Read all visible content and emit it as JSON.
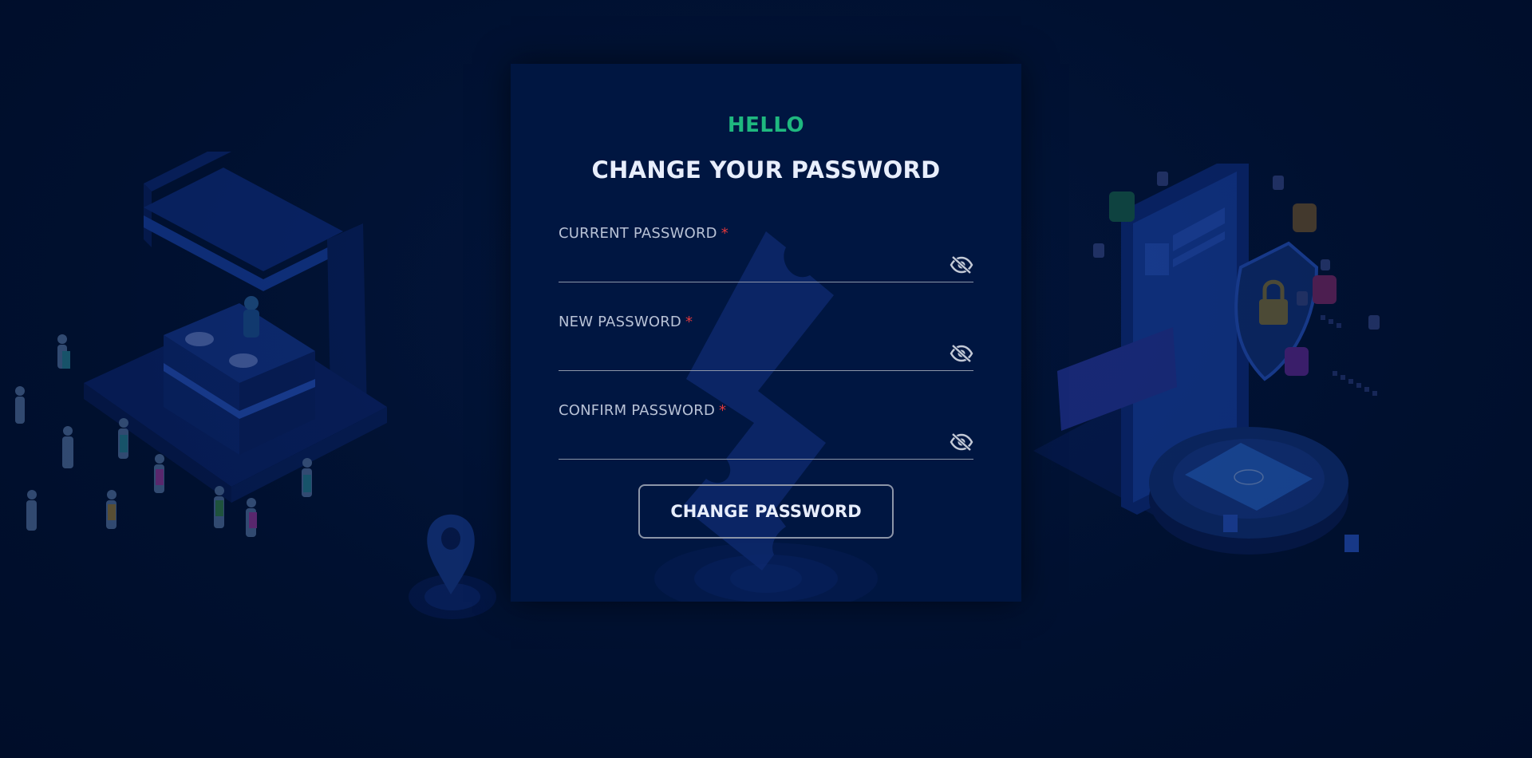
{
  "form": {
    "greeting": "HELLO",
    "title": "CHANGE YOUR PASSWORD",
    "fields": [
      {
        "label": "CURRENT PASSWORD",
        "required_mark": "*",
        "value": "",
        "icon": "eye-slash-icon"
      },
      {
        "label": "NEW PASSWORD",
        "required_mark": "*",
        "value": "",
        "icon": "eye-slash-icon"
      },
      {
        "label": "CONFIRM PASSWORD",
        "required_mark": "*",
        "value": "",
        "icon": "eye-slash-icon"
      }
    ],
    "submit_label": "CHANGE PASSWORD"
  },
  "colors": {
    "background": "#001033",
    "card": "#001641",
    "greeting": "#1fb87f",
    "title": "#e8eefc",
    "required": "#e2383c",
    "underline": "#8c95a8"
  }
}
